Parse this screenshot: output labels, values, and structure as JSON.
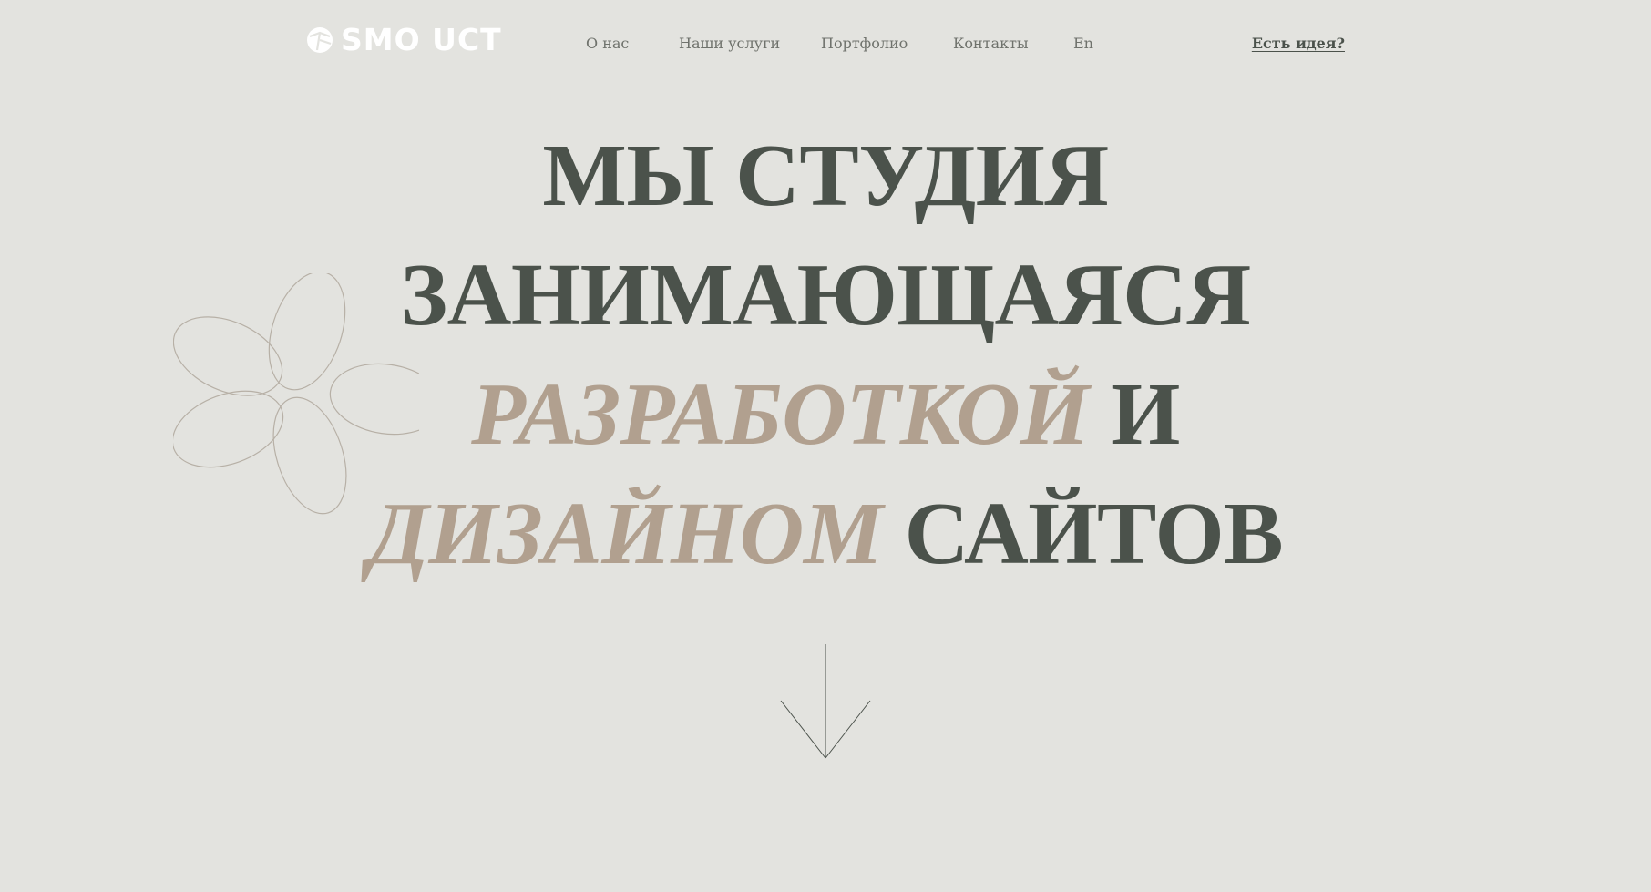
{
  "header": {
    "logo_text": "SMO UCT",
    "nav": [
      {
        "label": "О нас"
      },
      {
        "label": "Наши услуги"
      },
      {
        "label": "Портфолио"
      },
      {
        "label": "Контакты"
      },
      {
        "label": "En"
      }
    ],
    "cta_label": "Есть идея?"
  },
  "hero": {
    "line1": "МЫ СТУДИЯ",
    "line2": "ЗАНИМАЮЩАЯСЯ",
    "line3_accent": "РАЗРАБОТКОЙ",
    "line3_rest": "И",
    "line4_accent": "ДИЗАЙНОМ",
    "line4_rest": "САЙТОВ"
  },
  "icons": {
    "logo": "logo-mark-icon",
    "decoration": "flower-outline-icon",
    "scroll": "arrow-down-icon"
  },
  "colors": {
    "background": "#e3e3df",
    "text_dark": "#4b524b",
    "accent": "#b1a08f",
    "nav_text": "#6f726c",
    "logo": "#ffffff"
  }
}
